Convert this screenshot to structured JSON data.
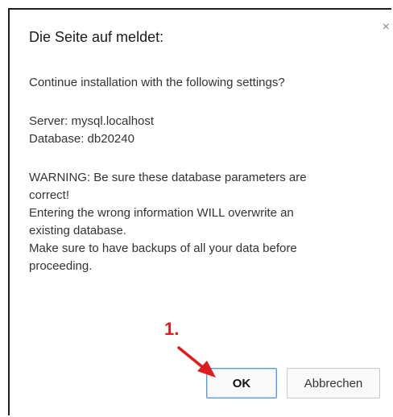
{
  "dialog": {
    "title": "Die Seite auf meldet:",
    "close_glyph": "×",
    "lines": [
      "Continue installation with the following settings?",
      "Server: mysql.localhost",
      "Database: db20240",
      "WARNING: Be sure these database parameters are",
      "correct!",
      "Entering the wrong information WILL overwrite an",
      "existing database.",
      "Make sure to have backups of all your data before",
      "proceeding."
    ],
    "ok_label": "OK",
    "cancel_label": "Abbrechen"
  },
  "annotation": {
    "step_label": "1.",
    "color": "#e01b1b"
  },
  "colors": {
    "ok_border": "#5b9be6",
    "button_bg": "#fafafa",
    "text": "#333333"
  }
}
